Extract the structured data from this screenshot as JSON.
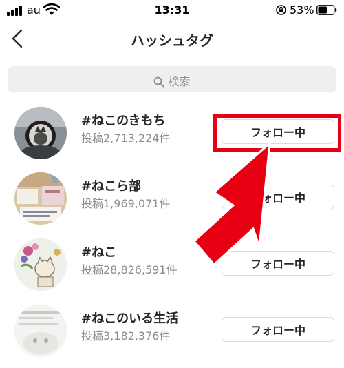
{
  "status_bar": {
    "carrier": "au",
    "time": "13:31",
    "battery": "53%"
  },
  "header": {
    "title": "ハッシュタグ"
  },
  "search": {
    "placeholder": "検索"
  },
  "hashtags": [
    {
      "tag": "#ねこのきもち",
      "count": "投稿2,713,224件",
      "button": "フォロー中"
    },
    {
      "tag": "#ねこら部",
      "count": "投稿1,969,071件",
      "button": "フォロー中"
    },
    {
      "tag": "#ねこ",
      "count": "投稿28,826,591件",
      "button": "フォロー中"
    },
    {
      "tag": "#ねこのいる生活",
      "count": "投稿3,182,376件",
      "button": "フォロー中"
    }
  ],
  "colors": {
    "annotation": "#e60012",
    "secondary_text": "#8e8e8e",
    "search_bg": "#efefef"
  },
  "icons": [
    "back-chevron-icon",
    "search-icon",
    "wifi-icon",
    "battery-icon",
    "rotation-lock-icon",
    "annotation-arrow-icon"
  ]
}
